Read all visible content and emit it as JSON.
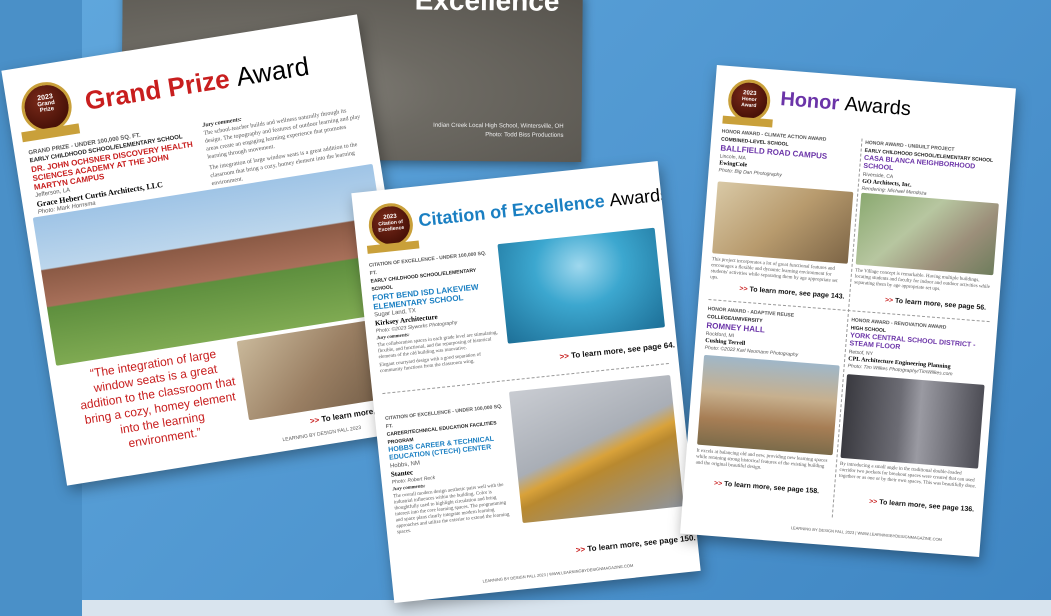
{
  "top_photo": {
    "title": "Excellence",
    "caption_line1": "Indian Creek Local High School, Wintersville, OH",
    "caption_line2": "Photo: Todd Biss Productions"
  },
  "grand_prize": {
    "badge_year": "2023",
    "badge_line1": "Grand",
    "badge_line2": "Prize",
    "heading_colored": "Grand Prize",
    "heading_plain": "Award",
    "category": "GRAND PRIZE - UNDER 100,000 SQ. FT.",
    "level": "EARLY CHILDHOOD SCHOOL/ELEMENTARY SCHOOL",
    "project": "DR. JOHN OCHSNER DISCOVERY HEALTH SCIENCES ACADEMY AT THE JOHN MARTYN CAMPUS",
    "location": "Jefferson, LA",
    "firm": "Grace Hebert Curtis Architects, LLC",
    "photo_credit": "Photo: Mark Hornsma",
    "jury_label": "Jury comments:",
    "jury_text": "The school-teacher builds and wellness naturally through its design. The topography and features of outdoor learning and play areas create an engaging learning experience that promotes learning through movement.",
    "jury_text2": "The integration of large window seats is a great addition to the classroom that bring a cozy, homey element into the learning environment.",
    "quote": "“The integration of large window seats is a great addition to the classroom that bring a cozy, homey element into the learning environment.”",
    "learn_more": "To learn more, see page",
    "footer": "LEARNING BY DESIGN FALL 2023"
  },
  "citation": {
    "badge_year": "2023",
    "badge_line1": "Citation of",
    "badge_line2": "Excellence",
    "heading_colored": "Citation of Excellence",
    "heading_plain": "Awards",
    "entry1": {
      "category": "CITATION OF EXCELLENCE - UNDER 100,000 SQ. FT.",
      "level": "EARLY CHILDHOOD SCHOOL/ELEMENTARY SCHOOL",
      "project": "FORT BEND ISD LAKEVIEW ELEMENTARY SCHOOL",
      "location": "Sugar Land, TX",
      "firm": "Kirksey Architecture",
      "photo_credit": "Photo: ©2023 Slyworks Photography",
      "jury_label": "Jury comments:",
      "jury_text": "The collaboration spaces in each grade level are stimulating, flexible, and functional, and the repurposing of historical elements of the old building was innovative.",
      "jury_text2": "Elegant courtyard design with a good separation of community functions from the classroom wing.",
      "learn_more": "To learn more, see page 64."
    },
    "entry2": {
      "category": "CITATION OF EXCELLENCE - UNDER 100,000 SQ. FT.",
      "level": "CAREER/TECHNICAL EDUCATION FACILITIES",
      "level2": "PROGRAM",
      "project": "HOBBS CAREER & TECHNICAL EDUCATION (CTECH) CENTER",
      "location": "Hobbs, NM",
      "firm": "Stantec",
      "photo_credit": "Photo: Robert Reck",
      "jury_label": "Jury comments:",
      "jury_text": "The overall modern design aesthetic pairs well with the industrial influences within the building. Color is thoughtfully used to highlight circulation and bring interest into the core learning spaces. The programming and space plans clearly integrate modern learning approaches and utilize the exterior to extend the learning spaces.",
      "learn_more": "To learn more, see page 150."
    },
    "footer": "LEARNING BY DESIGN FALL 2023 | WWW.LEARNINGBYDESIGNMAGAZINE.COM"
  },
  "honor": {
    "badge_year": "2023",
    "badge_line1": "Honor",
    "badge_line2": "Award",
    "heading_colored": "Honor",
    "heading_plain": "Awards",
    "entries": [
      {
        "category": "HONOR AWARD - CLIMATE ACTION AWARD",
        "level": "COMBINED-LEVEL SCHOOL",
        "project": "BALLFIELD ROAD CAMPUS",
        "location": "Lincoln, MA",
        "firm": "EwingCole",
        "photo_credit": "Photo: Big Dan Photography",
        "text": "This project incorporates a lot of great functional features and encourages a flexible and dynamic learning environment for students' activities while separating them by age appropriate set ups.",
        "learn_more": "To learn more, see page 143."
      },
      {
        "category": "HONOR AWARD - UNBUILT PROJECT",
        "level": "EARLY CHILDHOOD SCHOOL/ELEMENTARY SCHOOL",
        "project": "CASA BLANCA NEIGHBORHOOD SCHOOL",
        "location": "Riverside, CA",
        "firm": "GO Architects, Inc.",
        "photo_credit": "Rendering: Michael Mendoza",
        "text": "The Village concept is remarkable. Having multiple buildings, locating students and faculty for indoor and outdoor activities while separating them by age appropriate set ups.",
        "learn_more": "To learn more, see page 56."
      },
      {
        "category": "HONOR AWARD - ADAPTIVE REUSE",
        "level": "COLLEGE/UNIVERSITY",
        "project": "ROMNEY HALL",
        "location": "Rockford, MI",
        "firm": "Cushing Terrell",
        "photo_credit": "Photo: ©2022 Karl Neumann Photography",
        "text": "It excels at balancing old and new, providing new learning spaces while retaining strong historical features of the existing building and the original beautiful design.",
        "learn_more": "To learn more, see page 158."
      },
      {
        "category": "HONOR AWARD - RENOVATION AWARD",
        "level": "HIGH SCHOOL",
        "project": "YORK CENTRAL SCHOOL DISTRICT - STEAM FLOOR",
        "location": "Retsof, NY",
        "firm": "CPL Architecture Engineering Planning",
        "photo_credit": "Photo: Tim Wilkes Photography/TimWilkes.com",
        "text": "By introducing a small angle in the traditional double-loaded corridor two pockets for breakout spaces were created that can used together or as one or by their own spaces. This was beautifully done.",
        "learn_more": "To learn more, see page 136."
      }
    ],
    "footer": "LEARNING BY DESIGN FALL 2023 | WWW.LEARNINGBYDESIGNMAGAZINE.COM"
  },
  "colors": {
    "grand_red": "#c81e1e",
    "citation_blue": "#1a7fc2",
    "honor_purple": "#6b34a8",
    "background_blue": "#4e95cf"
  }
}
